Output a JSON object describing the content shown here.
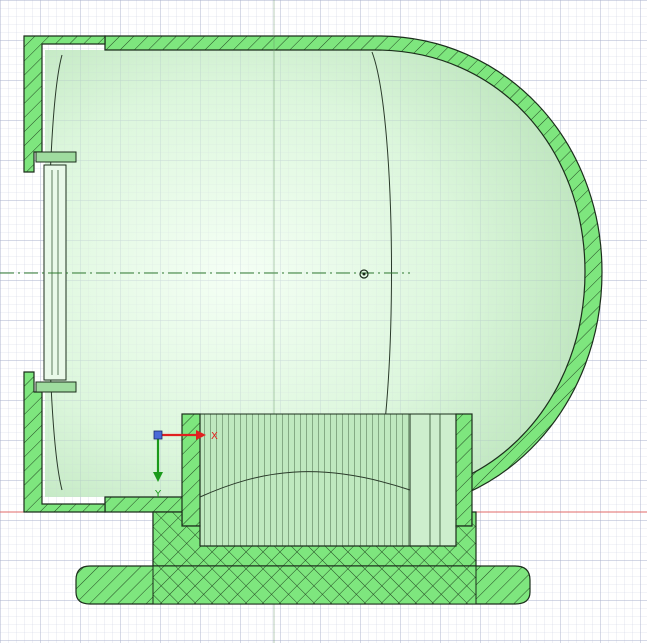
{
  "viewport": {
    "background_color": "#ffffff",
    "grid_minor_color": "#c9cde0",
    "grid_major_color": "#a9aec8",
    "section_fill_color": "#7de87d",
    "section_hatch_color": "#1f3d1f",
    "interior_color": "#c8f2c8",
    "axis_red_color": "#e02020",
    "axis_green_color": "#1a9a1a",
    "axis_blue_color": "#4a6ad8",
    "centerline_color": "#2f7a2f"
  },
  "triad": {
    "x_label": "X",
    "y_label": "Y",
    "origin_icon": "origin-point-icon"
  },
  "center_marker": {
    "icon": "center-point-icon"
  }
}
